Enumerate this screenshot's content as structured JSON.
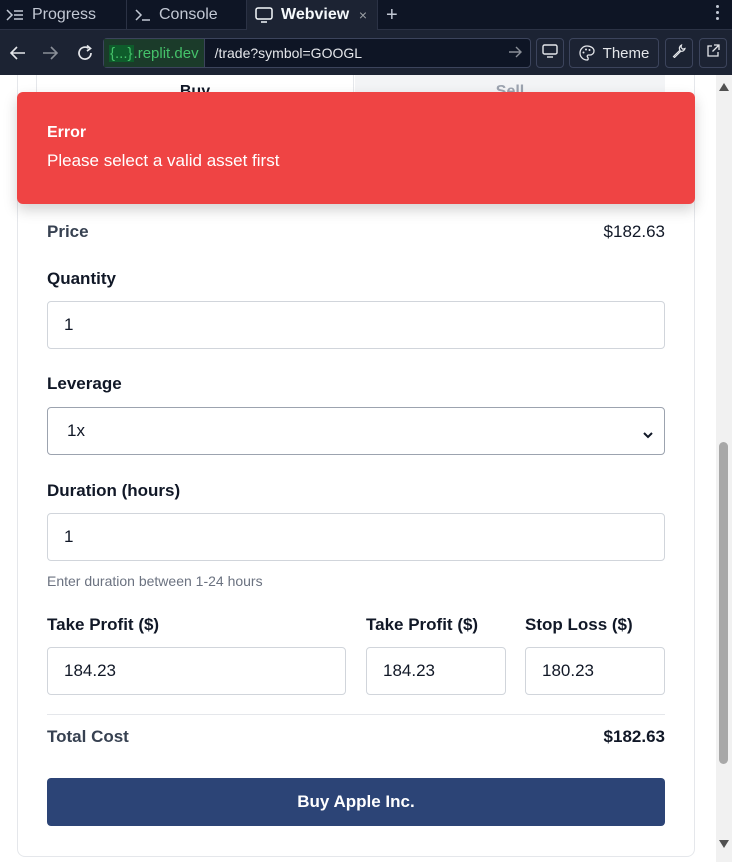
{
  "tabs": {
    "progress": "Progress",
    "console": "Console",
    "webview": "Webview",
    "close_glyph": "×",
    "add_glyph": "+"
  },
  "urlbar": {
    "host_prefix": "{...}",
    "host_suffix": ".replit.dev",
    "path": "/trade?symbol=GOOGL",
    "theme_label": "Theme"
  },
  "trade_tabs": {
    "buy": "Buy",
    "sell": "Sell"
  },
  "toast": {
    "title": "Error",
    "message": "Please select a valid asset first"
  },
  "form": {
    "price_label": "Price",
    "price_value": "$182.63",
    "quantity_label": "Quantity",
    "quantity_value": "1",
    "leverage_label": "Leverage",
    "leverage_value": "1x",
    "duration_label": "Duration (hours)",
    "duration_value": "1",
    "duration_hint": "Enter duration between 1-24 hours",
    "take_profit_label": "Take Profit ($)",
    "take_profit_value": "184.23",
    "take_profit_2_label": "Take Profit ($)",
    "take_profit_2_value": "184.23",
    "stop_loss_label": "Stop Loss ($)",
    "stop_loss_value": "180.23",
    "total_label": "Total Cost",
    "total_value": "$182.63",
    "submit_label": "Buy Apple Inc."
  },
  "colors": {
    "toast_bg": "#ef4444",
    "submit_bg": "#2c4476",
    "chrome_bg": "#1c2333",
    "host_green": "#45c26a"
  }
}
